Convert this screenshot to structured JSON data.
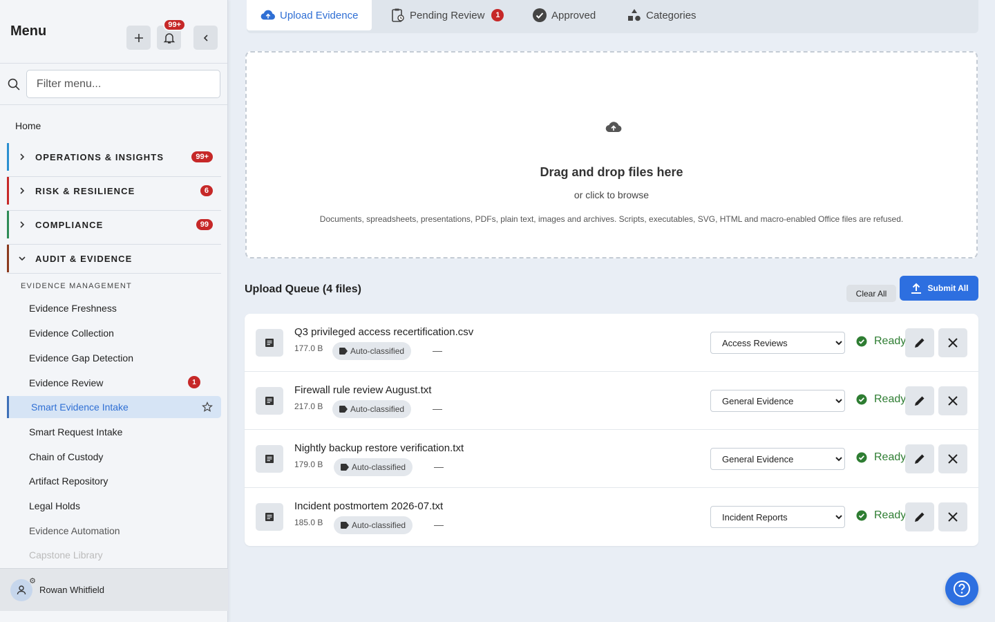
{
  "sidebar": {
    "title": "Menu",
    "notification_count": "99+",
    "filter_placeholder": "Filter menu...",
    "home": "Home",
    "sections": [
      {
        "label": "OPERATIONS & INSIGHTS",
        "count": "99+",
        "color": "#2a8fd0"
      },
      {
        "label": "RISK & RESILIENCE",
        "count": "6",
        "color": "#c62828"
      },
      {
        "label": "COMPLIANCE",
        "count": "99",
        "color": "#2e8b57"
      },
      {
        "label": "AUDIT & EVIDENCE",
        "count": "",
        "color": "#8b3a1e"
      }
    ],
    "group_label": "EVIDENCE MANAGEMENT",
    "items": [
      {
        "label": "Evidence Freshness"
      },
      {
        "label": "Evidence Collection"
      },
      {
        "label": "Evidence Gap Detection"
      },
      {
        "label": "Evidence Review",
        "badge": "1"
      },
      {
        "label": "Smart Evidence Intake"
      },
      {
        "label": "Smart Request Intake"
      },
      {
        "label": "Chain of Custody"
      },
      {
        "label": "Artifact Repository"
      },
      {
        "label": "Legal Holds"
      },
      {
        "label": "Evidence Automation"
      },
      {
        "label": "Capstone Library"
      }
    ],
    "user_name": "Rowan Whitfield"
  },
  "tabs": [
    {
      "label": "Upload Evidence",
      "icon": "cloud-upload-icon"
    },
    {
      "label": "Pending Review",
      "icon": "clipboard-clock-icon",
      "badge": "1"
    },
    {
      "label": "Approved",
      "icon": "check-circle-icon"
    },
    {
      "label": "Categories",
      "icon": "shapes-icon"
    }
  ],
  "dropzone": {
    "title": "Drag and drop files here",
    "subtitle": "or click to browse",
    "note": "Documents, spreadsheets, presentations, PDFs, plain text, images and archives. Scripts, executables, SVG, HTML and macro-enabled Office files are refused."
  },
  "queue": {
    "title": "Upload Queue (4 files)",
    "clear_label": "Clear All",
    "submit_label": "Submit All",
    "chip_label": "Auto-classified",
    "dash": "—",
    "status_label": "Ready",
    "category_options": [
      "Access Reviews",
      "General Evidence",
      "Incident Reports"
    ],
    "files": [
      {
        "name": "Q3 privileged access recertification.csv",
        "size": "177.0 B",
        "category": "Access Reviews"
      },
      {
        "name": "Firewall rule review August.txt",
        "size": "217.0 B",
        "category": "General Evidence"
      },
      {
        "name": "Nightly backup restore verification.txt",
        "size": "179.0 B",
        "category": "General Evidence"
      },
      {
        "name": "Incident postmortem 2026-07.txt",
        "size": "185.0 B",
        "category": "Incident Reports"
      }
    ]
  },
  "colors": {
    "accent": "#2d6fe0",
    "badge": "#c62828",
    "ready": "#2e7d32"
  }
}
